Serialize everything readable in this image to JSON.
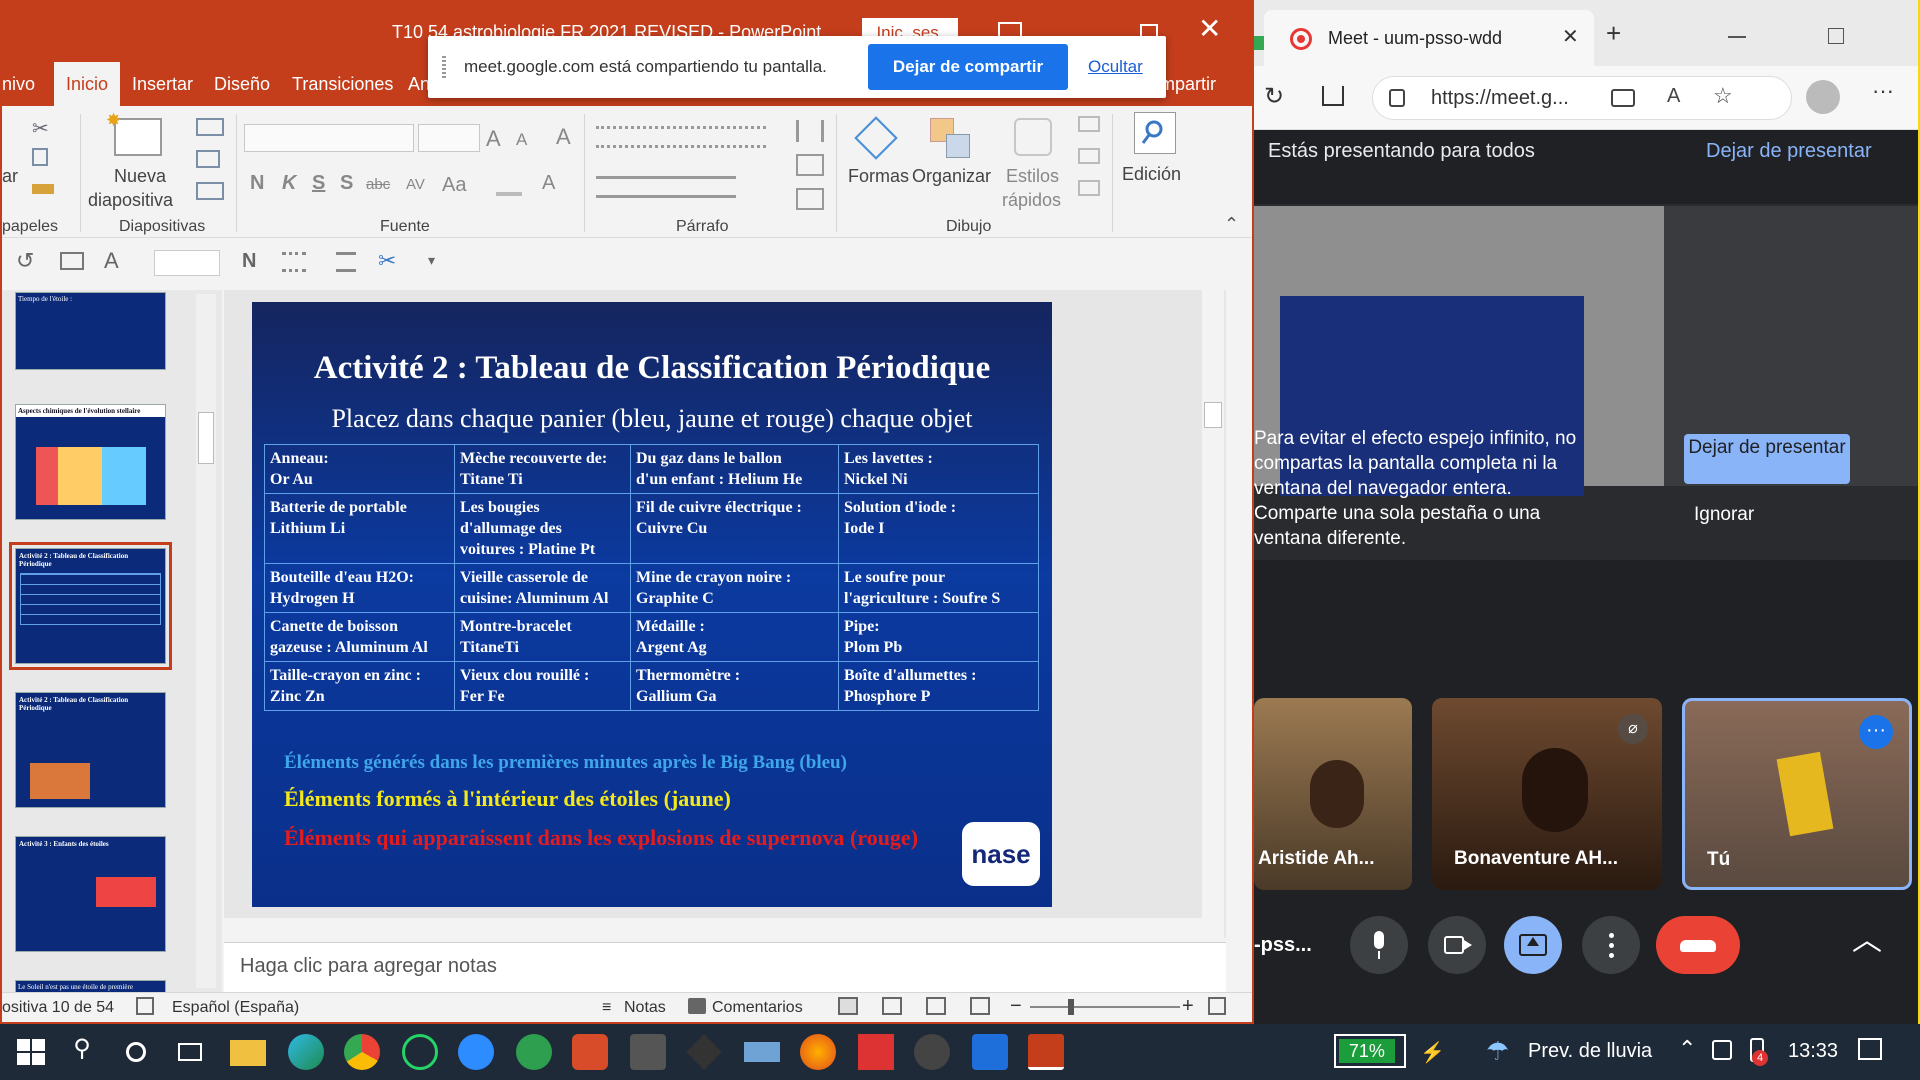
{
  "powerpoint": {
    "window_title": "T10 54 astrobiologie FR 2021 REVISED  -  PowerPoint",
    "signin": "Inic. ses.",
    "tabs": [
      "nivo",
      "Inicio",
      "Insertar",
      "Diseño",
      "Transiciones",
      "An",
      "ompartir"
    ],
    "ribbon": {
      "paste_partial": "ar",
      "clipboard_partial": "papeles",
      "new_slide_label": "Nueva",
      "new_slide_label2": "diapositiva",
      "slides_group": "Diapositivas",
      "font_group": "Fuente",
      "paragraph_group": "Párrafo",
      "shapes_label": "Formas",
      "arrange_label": "Organizar",
      "styles_label": "Estilos",
      "styles_label2": "rápidos",
      "drawing_group": "Dibujo",
      "editing_label": "Edición",
      "font_letters": [
        "N",
        "K",
        "S",
        "S",
        "abc",
        "AV",
        "Aa"
      ]
    },
    "sharing_banner": {
      "message": "meet.google.com está compartiendo tu pantalla.",
      "stop_button": "Dejar de compartir",
      "hide_link": "Ocultar"
    },
    "thumbnails": [
      {
        "title": "Tiempo de l'étoile :",
        "color": "#0b2a7a"
      },
      {
        "title": "Aspects chimiques de l'évolution stellaire",
        "color": "#0b2a7a"
      },
      {
        "title": "Activité 2 : Tableau de Classification Périodique",
        "color": "#0b2a7a"
      },
      {
        "title": "Activité 2 : Tableau de Classification Périodique",
        "color": "#0b2a7a"
      },
      {
        "title": "Activité 3 : Enfants des étoiles",
        "color": "#0b2a7a"
      },
      {
        "title": "Le Soleil n'est pas une étoile de première",
        "color": "#0b2a7a"
      }
    ],
    "slide": {
      "title": "Activité 2 : Tableau de Classification Périodique",
      "subtitle": "Placez dans chaque panier (bleu, jaune et rouge) chaque objet",
      "table": [
        [
          "Anneau:\nOr Au",
          "Mèche recouverte de:\nTitane Ti",
          "Du gaz dans le ballon\nd'un enfant : Helium He",
          "Les lavettes :\n Nickel Ni"
        ],
        [
          "Batterie de portable\nLithium Li",
          "Les bougies\nd'allumage des\nvoitures : Platine Pt",
          "Fil de cuivre électrique :\nCuivre Cu",
          "Solution d'iode :\nIode I"
        ],
        [
          "Bouteille d'eau H2O:\nHydrogen H",
          "Vieille casserole de\ncuisine: Aluminum Al",
          "Mine de crayon noire :\nGraphite C",
          "Le soufre pour\nl'agriculture : Soufre S"
        ],
        [
          "Canette de boisson\ngazeuse : Aluminum Al",
          "Montre-bracelet\nTitaneTi",
          "Médaille :\nArgent Ag",
          "Pipe:\nPlom Pb"
        ],
        [
          "Taille-crayon en zinc :\nZinc Zn",
          "Vieux clou rouillé :\nFer Fe",
          "Thermomètre :\nGallium  Ga",
          "Boîte d'allumettes :\nPhosphore P"
        ]
      ],
      "legend_blue": "Éléments générés dans les premières minutes après le Big Bang (bleu)",
      "legend_yellow": "Éléments formés à l'intérieur des étoiles (jaune)",
      "legend_red": "Éléments qui apparaissent dans les explosions de supernova (rouge)",
      "logo": "nase"
    },
    "notes_placeholder": "Haga clic para agregar notas",
    "status": {
      "slide_counter": "ositiva 10 de 54",
      "language": "Español (España)",
      "notes": "Notas",
      "comments": "Comentarios"
    }
  },
  "edge": {
    "tab_title": "Meet - uum-psso-wdd",
    "url": "https://meet.g...",
    "meet": {
      "presenting_text": "Estás presentando para todos",
      "stop_presenting": "Dejar de presentar",
      "mirror_warning": [
        "Para evitar el efecto espejo infinito, no",
        "compartas la pantalla completa ni la",
        "ventana del navegador entera.",
        "Comparte una sola pestaña o una",
        "ventana diferente."
      ],
      "popup_stop_button": "Dejar de presentar",
      "ignore_button": "Ignorar",
      "participants": [
        {
          "name": "Aristide Ah...",
          "muted": false
        },
        {
          "name": "Bonaventure AH...",
          "muted": true
        },
        {
          "name": "Tú",
          "muted": false
        }
      ],
      "meeting_code_partial": "-pss..."
    }
  },
  "taskbar": {
    "battery": "71%",
    "weather": "Prev. de lluvia",
    "time": "13:33",
    "notification_badge": "4"
  }
}
